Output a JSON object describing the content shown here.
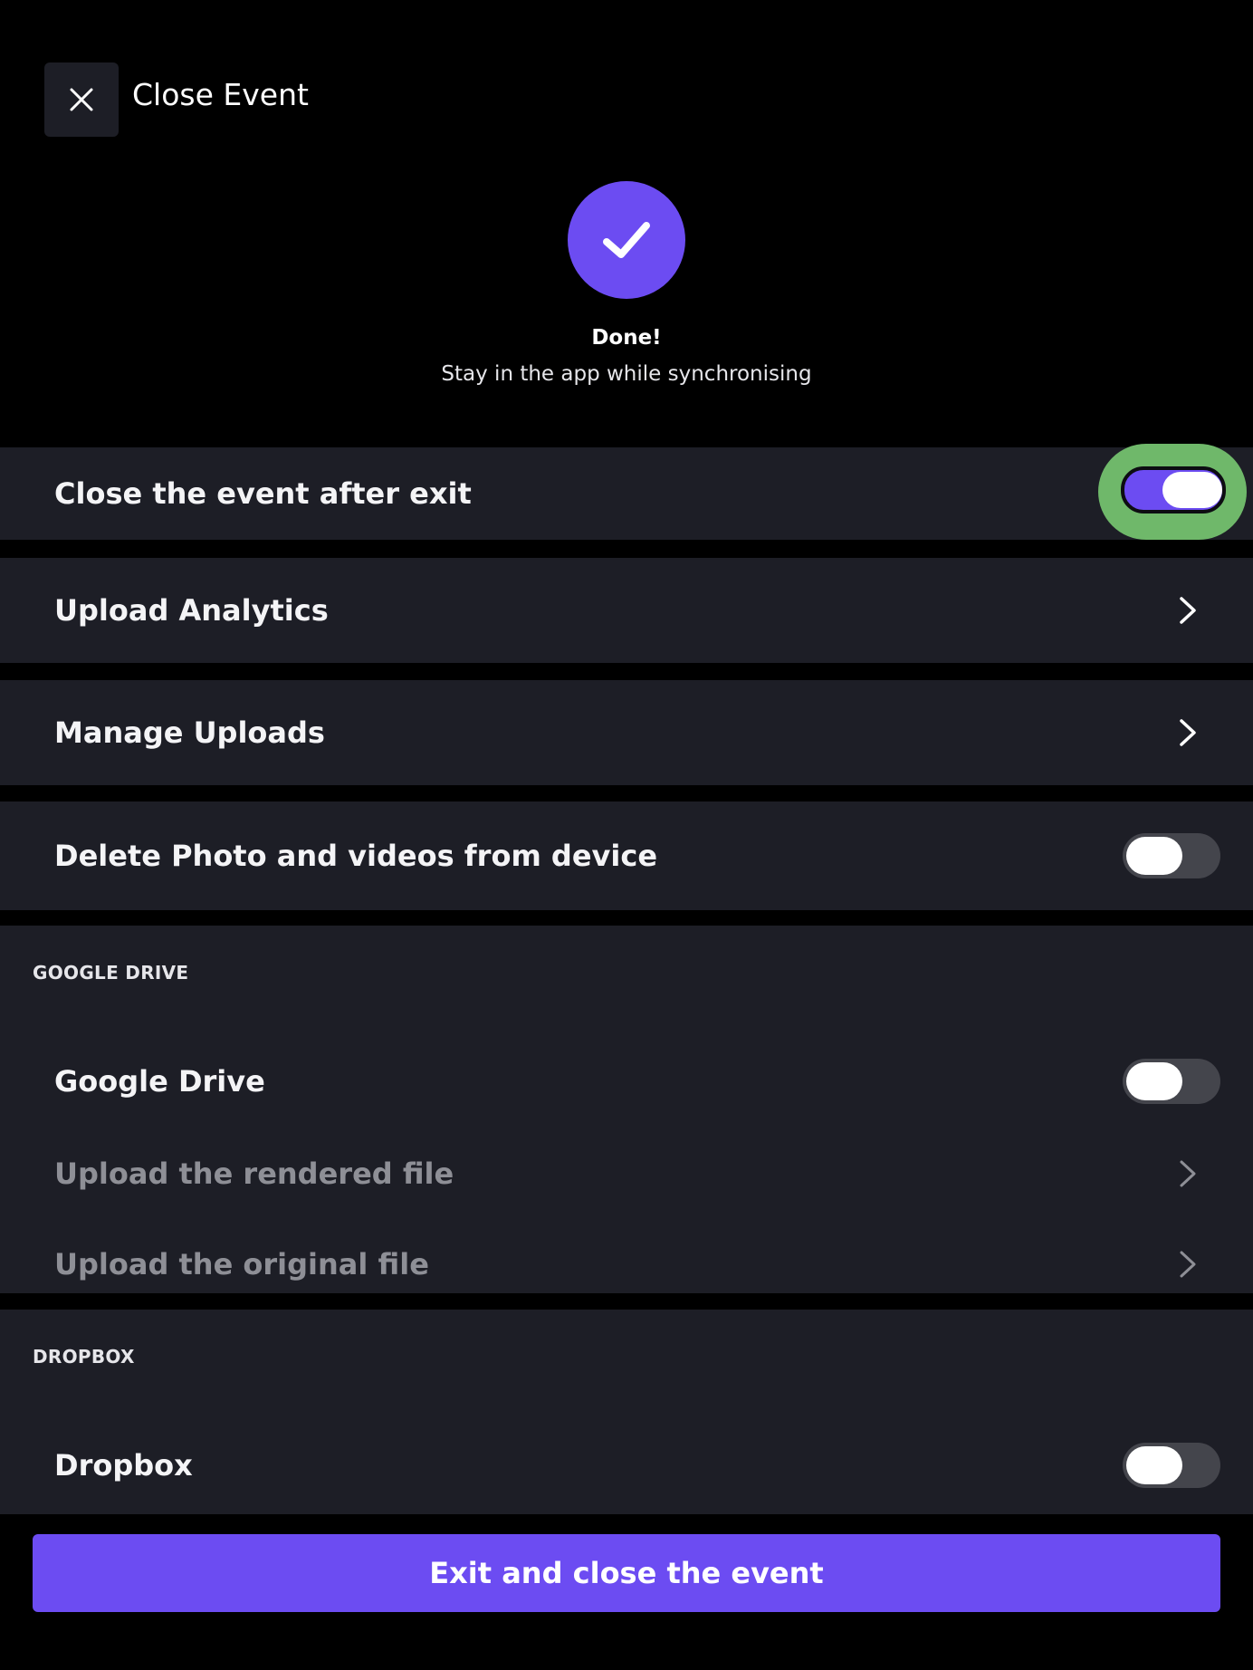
{
  "header": {
    "title": "Close Event",
    "close_icon": "close-icon"
  },
  "status": {
    "icon": "check-icon",
    "title": "Done!",
    "subtitle": "Stay in the app while synchronising"
  },
  "settings": {
    "close_after_exit": {
      "label": "Close the event after exit",
      "enabled": true
    },
    "upload_analytics": {
      "label": "Upload Analytics"
    },
    "manage_uploads": {
      "label": "Manage Uploads"
    },
    "delete_media": {
      "label": "Delete Photo and videos from device",
      "enabled": false
    }
  },
  "google_drive": {
    "section_label": "GOOGLE DRIVE",
    "toggle_label": "Google Drive",
    "enabled": false,
    "upload_rendered": "Upload the rendered file",
    "upload_original": "Upload the original file"
  },
  "dropbox": {
    "section_label": "DROPBOX",
    "toggle_label": "Dropbox",
    "enabled": false
  },
  "footer": {
    "exit_button": "Exit and close the event"
  },
  "colors": {
    "accent": "#6c4cf2",
    "card": "#1d1e26",
    "background": "#000000",
    "highlight": "#6fb86a"
  }
}
